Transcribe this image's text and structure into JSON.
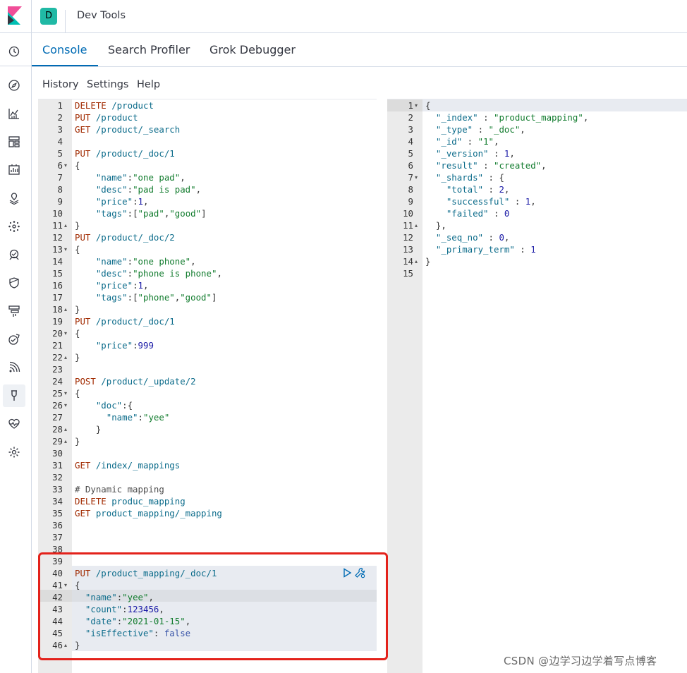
{
  "header": {
    "space_initial": "D",
    "app_title": "Dev Tools"
  },
  "colors": {
    "accent": "#006bb4",
    "badge": "#20b9a5",
    "highlight_box": "#e3221b"
  },
  "nav_icons": [
    "clock-icon",
    "compass-icon",
    "visualize-icon",
    "dashboard-icon",
    "canvas-icon",
    "maps-icon",
    "ml-icon",
    "graph-icon",
    "siem-icon",
    "apm-icon",
    "uptime-icon",
    "logs-icon",
    "devtools-icon",
    "monitoring-icon",
    "management-icon"
  ],
  "tabs": [
    {
      "label": "Console",
      "active": true
    },
    {
      "label": "Search Profiler",
      "active": false
    },
    {
      "label": "Grok Debugger",
      "active": false
    }
  ],
  "submenu": [
    "History",
    "Settings",
    "Help"
  ],
  "request_lines": [
    {
      "n": "1",
      "fold": "",
      "tokens": [
        {
          "t": "DELETE",
          "c": "c-method"
        },
        {
          "t": " /product",
          "c": "c-url"
        }
      ]
    },
    {
      "n": "2",
      "fold": "",
      "tokens": [
        {
          "t": "PUT",
          "c": "c-method"
        },
        {
          "t": " /product",
          "c": "c-url"
        }
      ]
    },
    {
      "n": "3",
      "fold": "",
      "tokens": [
        {
          "t": "GET",
          "c": "c-method"
        },
        {
          "t": " /product/_search",
          "c": "c-url"
        }
      ]
    },
    {
      "n": "4",
      "fold": "",
      "tokens": []
    },
    {
      "n": "5",
      "fold": "",
      "tokens": [
        {
          "t": "PUT",
          "c": "c-method"
        },
        {
          "t": " /product/_doc/1",
          "c": "c-url"
        }
      ]
    },
    {
      "n": "6",
      "fold": "▾",
      "tokens": [
        {
          "t": "{",
          "c": "c-punc"
        }
      ]
    },
    {
      "n": "7",
      "fold": "",
      "tokens": [
        {
          "t": "    \"name\"",
          "c": "c-key"
        },
        {
          "t": ":",
          "c": "c-punc"
        },
        {
          "t": "\"one pad\"",
          "c": "c-str"
        },
        {
          "t": ",",
          "c": "c-punc"
        }
      ]
    },
    {
      "n": "8",
      "fold": "",
      "tokens": [
        {
          "t": "    \"desc\"",
          "c": "c-key"
        },
        {
          "t": ":",
          "c": "c-punc"
        },
        {
          "t": "\"pad is pad\"",
          "c": "c-str"
        },
        {
          "t": ",",
          "c": "c-punc"
        }
      ]
    },
    {
      "n": "9",
      "fold": "",
      "tokens": [
        {
          "t": "    \"price\"",
          "c": "c-key"
        },
        {
          "t": ":",
          "c": "c-punc"
        },
        {
          "t": "1",
          "c": "c-num"
        },
        {
          "t": ",",
          "c": "c-punc"
        }
      ]
    },
    {
      "n": "10",
      "fold": "",
      "tokens": [
        {
          "t": "    \"tags\"",
          "c": "c-key"
        },
        {
          "t": ":[",
          "c": "c-punc"
        },
        {
          "t": "\"pad\"",
          "c": "c-str"
        },
        {
          "t": ",",
          "c": "c-punc"
        },
        {
          "t": "\"good\"",
          "c": "c-str"
        },
        {
          "t": "]",
          "c": "c-punc"
        }
      ]
    },
    {
      "n": "11",
      "fold": "▴",
      "tokens": [
        {
          "t": "}",
          "c": "c-punc"
        }
      ]
    },
    {
      "n": "12",
      "fold": "",
      "tokens": [
        {
          "t": "PUT",
          "c": "c-method"
        },
        {
          "t": " /product/_doc/2",
          "c": "c-url"
        }
      ]
    },
    {
      "n": "13",
      "fold": "▾",
      "tokens": [
        {
          "t": "{",
          "c": "c-punc"
        }
      ]
    },
    {
      "n": "14",
      "fold": "",
      "tokens": [
        {
          "t": "    \"name\"",
          "c": "c-key"
        },
        {
          "t": ":",
          "c": "c-punc"
        },
        {
          "t": "\"one phone\"",
          "c": "c-str"
        },
        {
          "t": ",",
          "c": "c-punc"
        }
      ]
    },
    {
      "n": "15",
      "fold": "",
      "tokens": [
        {
          "t": "    \"desc\"",
          "c": "c-key"
        },
        {
          "t": ":",
          "c": "c-punc"
        },
        {
          "t": "\"phone is phone\"",
          "c": "c-str"
        },
        {
          "t": ",",
          "c": "c-punc"
        }
      ]
    },
    {
      "n": "16",
      "fold": "",
      "tokens": [
        {
          "t": "    \"price\"",
          "c": "c-key"
        },
        {
          "t": ":",
          "c": "c-punc"
        },
        {
          "t": "1",
          "c": "c-num"
        },
        {
          "t": ",",
          "c": "c-punc"
        }
      ]
    },
    {
      "n": "17",
      "fold": "",
      "tokens": [
        {
          "t": "    \"tags\"",
          "c": "c-key"
        },
        {
          "t": ":[",
          "c": "c-punc"
        },
        {
          "t": "\"phone\"",
          "c": "c-str"
        },
        {
          "t": ",",
          "c": "c-punc"
        },
        {
          "t": "\"good\"",
          "c": "c-str"
        },
        {
          "t": "]",
          "c": "c-punc"
        }
      ]
    },
    {
      "n": "18",
      "fold": "▴",
      "tokens": [
        {
          "t": "}",
          "c": "c-punc"
        }
      ]
    },
    {
      "n": "19",
      "fold": "",
      "tokens": [
        {
          "t": "PUT",
          "c": "c-method"
        },
        {
          "t": " /product/_doc/1",
          "c": "c-url"
        }
      ]
    },
    {
      "n": "20",
      "fold": "▾",
      "tokens": [
        {
          "t": "{",
          "c": "c-punc"
        }
      ]
    },
    {
      "n": "21",
      "fold": "",
      "tokens": [
        {
          "t": "    \"price\"",
          "c": "c-key"
        },
        {
          "t": ":",
          "c": "c-punc"
        },
        {
          "t": "999",
          "c": "c-num"
        }
      ]
    },
    {
      "n": "22",
      "fold": "▴",
      "tokens": [
        {
          "t": "}",
          "c": "c-punc"
        }
      ]
    },
    {
      "n": "23",
      "fold": "",
      "tokens": []
    },
    {
      "n": "24",
      "fold": "",
      "tokens": [
        {
          "t": "POST",
          "c": "c-method"
        },
        {
          "t": " /product/_update/2",
          "c": "c-url"
        }
      ]
    },
    {
      "n": "25",
      "fold": "▾",
      "tokens": [
        {
          "t": "{",
          "c": "c-punc"
        }
      ]
    },
    {
      "n": "26",
      "fold": "▾",
      "tokens": [
        {
          "t": "    \"doc\"",
          "c": "c-key"
        },
        {
          "t": ":{",
          "c": "c-punc"
        }
      ]
    },
    {
      "n": "27",
      "fold": "",
      "tokens": [
        {
          "t": "      \"name\"",
          "c": "c-key"
        },
        {
          "t": ":",
          "c": "c-punc"
        },
        {
          "t": "\"yee\"",
          "c": "c-str"
        }
      ]
    },
    {
      "n": "28",
      "fold": "▴",
      "tokens": [
        {
          "t": "    }",
          "c": "c-punc"
        }
      ]
    },
    {
      "n": "29",
      "fold": "▴",
      "tokens": [
        {
          "t": "}",
          "c": "c-punc"
        }
      ]
    },
    {
      "n": "30",
      "fold": "",
      "tokens": []
    },
    {
      "n": "31",
      "fold": "",
      "tokens": [
        {
          "t": "GET",
          "c": "c-method"
        },
        {
          "t": " /index/_mappings",
          "c": "c-url"
        }
      ]
    },
    {
      "n": "32",
      "fold": "",
      "tokens": []
    },
    {
      "n": "33",
      "fold": "",
      "tokens": [
        {
          "t": "# Dynamic mapping",
          "c": "c-comment"
        }
      ]
    },
    {
      "n": "34",
      "fold": "",
      "tokens": [
        {
          "t": "DELETE",
          "c": "c-method"
        },
        {
          "t": " produc_mapping",
          "c": "c-url"
        }
      ]
    },
    {
      "n": "35",
      "fold": "",
      "tokens": [
        {
          "t": "GET",
          "c": "c-method"
        },
        {
          "t": " product_mapping/_mapping",
          "c": "c-url"
        }
      ]
    },
    {
      "n": "36",
      "fold": "",
      "tokens": []
    },
    {
      "n": "37",
      "fold": "",
      "tokens": []
    },
    {
      "n": "38",
      "fold": "",
      "tokens": []
    },
    {
      "n": "39",
      "fold": "",
      "tokens": []
    },
    {
      "n": "40",
      "fold": "",
      "tokens": [
        {
          "t": "PUT",
          "c": "c-method"
        },
        {
          "t": " /product_mapping/_doc/1",
          "c": "c-url"
        }
      ]
    },
    {
      "n": "41",
      "fold": "▾",
      "tokens": [
        {
          "t": "{",
          "c": "c-punc"
        }
      ]
    },
    {
      "n": "42",
      "fold": "",
      "tokens": [
        {
          "t": "  \"name\"",
          "c": "c-key"
        },
        {
          "t": ":",
          "c": "c-punc"
        },
        {
          "t": "\"yee\"",
          "c": "c-str"
        },
        {
          "t": ",",
          "c": "c-punc"
        }
      ]
    },
    {
      "n": "43",
      "fold": "",
      "tokens": [
        {
          "t": "  \"count\"",
          "c": "c-key"
        },
        {
          "t": ":",
          "c": "c-punc"
        },
        {
          "t": "123456",
          "c": "c-num"
        },
        {
          "t": ",",
          "c": "c-punc"
        }
      ]
    },
    {
      "n": "44",
      "fold": "",
      "tokens": [
        {
          "t": "  \"date\"",
          "c": "c-key"
        },
        {
          "t": ":",
          "c": "c-punc"
        },
        {
          "t": "\"2021-01-15\"",
          "c": "c-str"
        },
        {
          "t": ",",
          "c": "c-punc"
        }
      ]
    },
    {
      "n": "45",
      "fold": "",
      "tokens": [
        {
          "t": "  \"isEffective\"",
          "c": "c-key"
        },
        {
          "t": ": ",
          "c": "c-punc"
        },
        {
          "t": "false",
          "c": "c-bool"
        }
      ]
    },
    {
      "n": "46",
      "fold": "▴",
      "tokens": [
        {
          "t": "}",
          "c": "c-punc"
        }
      ]
    }
  ],
  "response_lines": [
    {
      "n": "1",
      "fold": "▾",
      "tokens": [
        {
          "t": "{",
          "c": "c-punc"
        }
      ]
    },
    {
      "n": "2",
      "fold": "",
      "tokens": [
        {
          "t": "  \"_index\"",
          "c": "c-key"
        },
        {
          "t": " : ",
          "c": "c-punc"
        },
        {
          "t": "\"product_mapping\"",
          "c": "c-str"
        },
        {
          "t": ",",
          "c": "c-punc"
        }
      ]
    },
    {
      "n": "3",
      "fold": "",
      "tokens": [
        {
          "t": "  \"_type\"",
          "c": "c-key"
        },
        {
          "t": " : ",
          "c": "c-punc"
        },
        {
          "t": "\"_doc\"",
          "c": "c-str"
        },
        {
          "t": ",",
          "c": "c-punc"
        }
      ]
    },
    {
      "n": "4",
      "fold": "",
      "tokens": [
        {
          "t": "  \"_id\"",
          "c": "c-key"
        },
        {
          "t": " : ",
          "c": "c-punc"
        },
        {
          "t": "\"1\"",
          "c": "c-str"
        },
        {
          "t": ",",
          "c": "c-punc"
        }
      ]
    },
    {
      "n": "5",
      "fold": "",
      "tokens": [
        {
          "t": "  \"_version\"",
          "c": "c-key"
        },
        {
          "t": " : ",
          "c": "c-punc"
        },
        {
          "t": "1",
          "c": "c-num"
        },
        {
          "t": ",",
          "c": "c-punc"
        }
      ]
    },
    {
      "n": "6",
      "fold": "",
      "tokens": [
        {
          "t": "  \"result\"",
          "c": "c-key"
        },
        {
          "t": " : ",
          "c": "c-punc"
        },
        {
          "t": "\"created\"",
          "c": "c-str"
        },
        {
          "t": ",",
          "c": "c-punc"
        }
      ]
    },
    {
      "n": "7",
      "fold": "▾",
      "tokens": [
        {
          "t": "  \"_shards\"",
          "c": "c-key"
        },
        {
          "t": " : {",
          "c": "c-punc"
        }
      ]
    },
    {
      "n": "8",
      "fold": "",
      "tokens": [
        {
          "t": "    \"total\"",
          "c": "c-key"
        },
        {
          "t": " : ",
          "c": "c-punc"
        },
        {
          "t": "2",
          "c": "c-num"
        },
        {
          "t": ",",
          "c": "c-punc"
        }
      ]
    },
    {
      "n": "9",
      "fold": "",
      "tokens": [
        {
          "t": "    \"successful\"",
          "c": "c-key"
        },
        {
          "t": " : ",
          "c": "c-punc"
        },
        {
          "t": "1",
          "c": "c-num"
        },
        {
          "t": ",",
          "c": "c-punc"
        }
      ]
    },
    {
      "n": "10",
      "fold": "",
      "tokens": [
        {
          "t": "    \"failed\"",
          "c": "c-key"
        },
        {
          "t": " : ",
          "c": "c-punc"
        },
        {
          "t": "0",
          "c": "c-num"
        }
      ]
    },
    {
      "n": "11",
      "fold": "▴",
      "tokens": [
        {
          "t": "  },",
          "c": "c-punc"
        }
      ]
    },
    {
      "n": "12",
      "fold": "",
      "tokens": [
        {
          "t": "  \"_seq_no\"",
          "c": "c-key"
        },
        {
          "t": " : ",
          "c": "c-punc"
        },
        {
          "t": "0",
          "c": "c-num"
        },
        {
          "t": ",",
          "c": "c-punc"
        }
      ]
    },
    {
      "n": "13",
      "fold": "",
      "tokens": [
        {
          "t": "  \"_primary_term\"",
          "c": "c-key"
        },
        {
          "t": " : ",
          "c": "c-punc"
        },
        {
          "t": "1",
          "c": "c-num"
        }
      ]
    },
    {
      "n": "14",
      "fold": "▴",
      "tokens": [
        {
          "t": "}",
          "c": "c-punc"
        }
      ]
    },
    {
      "n": "15",
      "fold": "",
      "tokens": []
    }
  ],
  "watermark": "CSDN @边学习边学着写点博客"
}
